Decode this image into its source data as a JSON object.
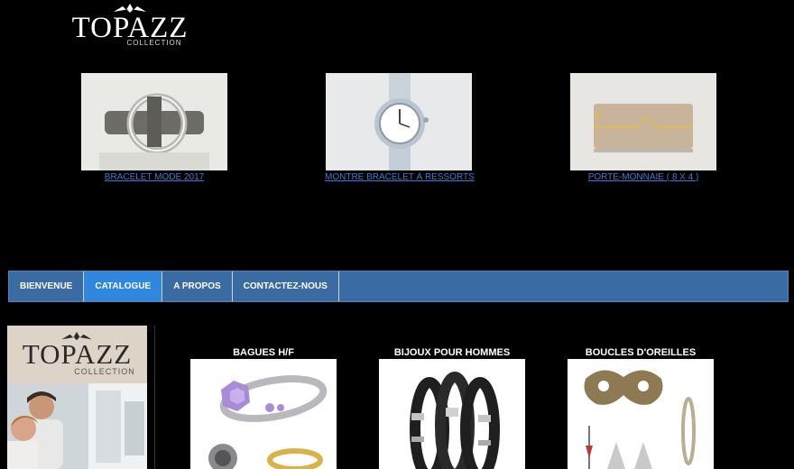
{
  "brand": {
    "name": "TOPAZZ",
    "tagline": "COLLECTION"
  },
  "featured": [
    {
      "label": "BRACELET MODE 2017",
      "image": "bracelet-photo"
    },
    {
      "label": "MONTRE BRACELET À RESSORTS",
      "image": "watch-photo"
    },
    {
      "label": "PORTE-MONNAIE ( 8 X 4 )",
      "image": "wallet-photo"
    }
  ],
  "nav": [
    {
      "label": "BIENVENUE",
      "active": false
    },
    {
      "label": "CATALOGUE",
      "active": true
    },
    {
      "label": "A PROPOS",
      "active": false
    },
    {
      "label": "CONTACTEZ-NOUS",
      "active": false
    }
  ],
  "categories": [
    {
      "title": "BAGUES H/F",
      "image": "rings-photo"
    },
    {
      "title": "BIJOUX POUR HOMMES",
      "image": "men-bracelets-photo"
    },
    {
      "title": "BOUCLES D'OREILLES",
      "image": "earrings-photo"
    }
  ],
  "colors": {
    "background": "#000000",
    "nav_bg": "#3a6ca3",
    "nav_active": "#2f87e0",
    "link": "#3b7bd4"
  }
}
